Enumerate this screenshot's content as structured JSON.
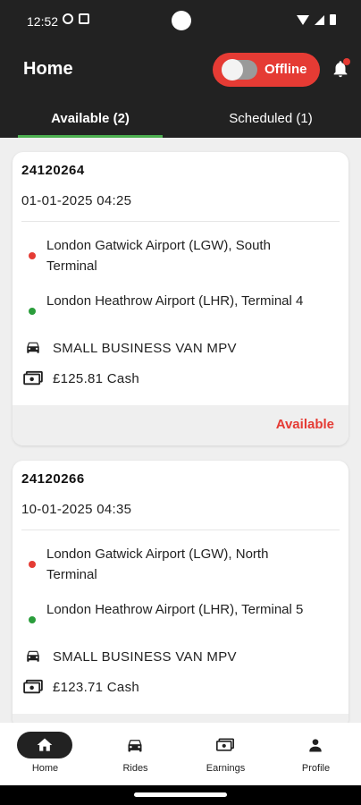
{
  "status_bar": {
    "time": "12:52"
  },
  "header": {
    "title": "Home",
    "toggle_label": "Offline"
  },
  "tabs": [
    {
      "label": "Available (2)"
    },
    {
      "label": "Scheduled (1)"
    }
  ],
  "rides": [
    {
      "id": "24120264",
      "datetime": "01-01-2025 04:25",
      "pickup": "London Gatwick Airport (LGW), South Terminal",
      "dropoff": "London Heathrow Airport (LHR), Terminal 4",
      "vehicle": "SMALL BUSINESS VAN MPV",
      "fare": "£125.81 Cash",
      "status": "Available"
    },
    {
      "id": "24120266",
      "datetime": "10-01-2025 04:35",
      "pickup": "London Gatwick Airport (LGW), North Terminal",
      "dropoff": "London Heathrow Airport (LHR), Terminal 5",
      "vehicle": "SMALL BUSINESS VAN MPV",
      "fare": "£123.71 Cash",
      "status": ""
    }
  ],
  "bottom_nav": [
    {
      "label": "Home",
      "icon": "home-icon"
    },
    {
      "label": "Rides",
      "icon": "car-icon"
    },
    {
      "label": "Earnings",
      "icon": "cash-icon"
    },
    {
      "label": "Profile",
      "icon": "person-icon"
    }
  ],
  "colors": {
    "accent": "#e53b34",
    "header": "#222222",
    "tab_indicator": "#4caf50",
    "dropoff_dot": "#2a9d3b"
  }
}
